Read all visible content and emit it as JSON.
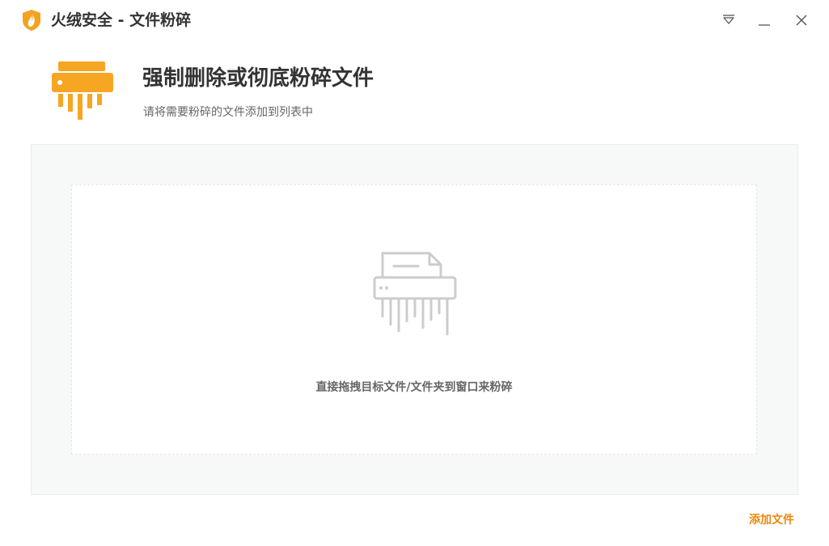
{
  "window": {
    "title": "火绒安全 - 文件粉碎",
    "controls": {
      "menu_icon": "dropdown-menu-icon",
      "minimize_icon": "minimize-icon",
      "close_icon": "close-icon"
    }
  },
  "header": {
    "icon": "shredder-icon",
    "title": "强制删除或彻底粉碎文件",
    "subtitle": "请将需要粉碎的文件添加到列表中"
  },
  "drop_area": {
    "illustration": "file-shredder-icon",
    "hint": "直接拖拽目标文件/文件夹到窗口来粉碎"
  },
  "footer": {
    "add_file_label": "添加文件"
  },
  "colors": {
    "accent": "#f6a623",
    "link": "#e8890c",
    "panel_bg": "#f7f8f8",
    "illustration_gray": "#cccccc"
  }
}
